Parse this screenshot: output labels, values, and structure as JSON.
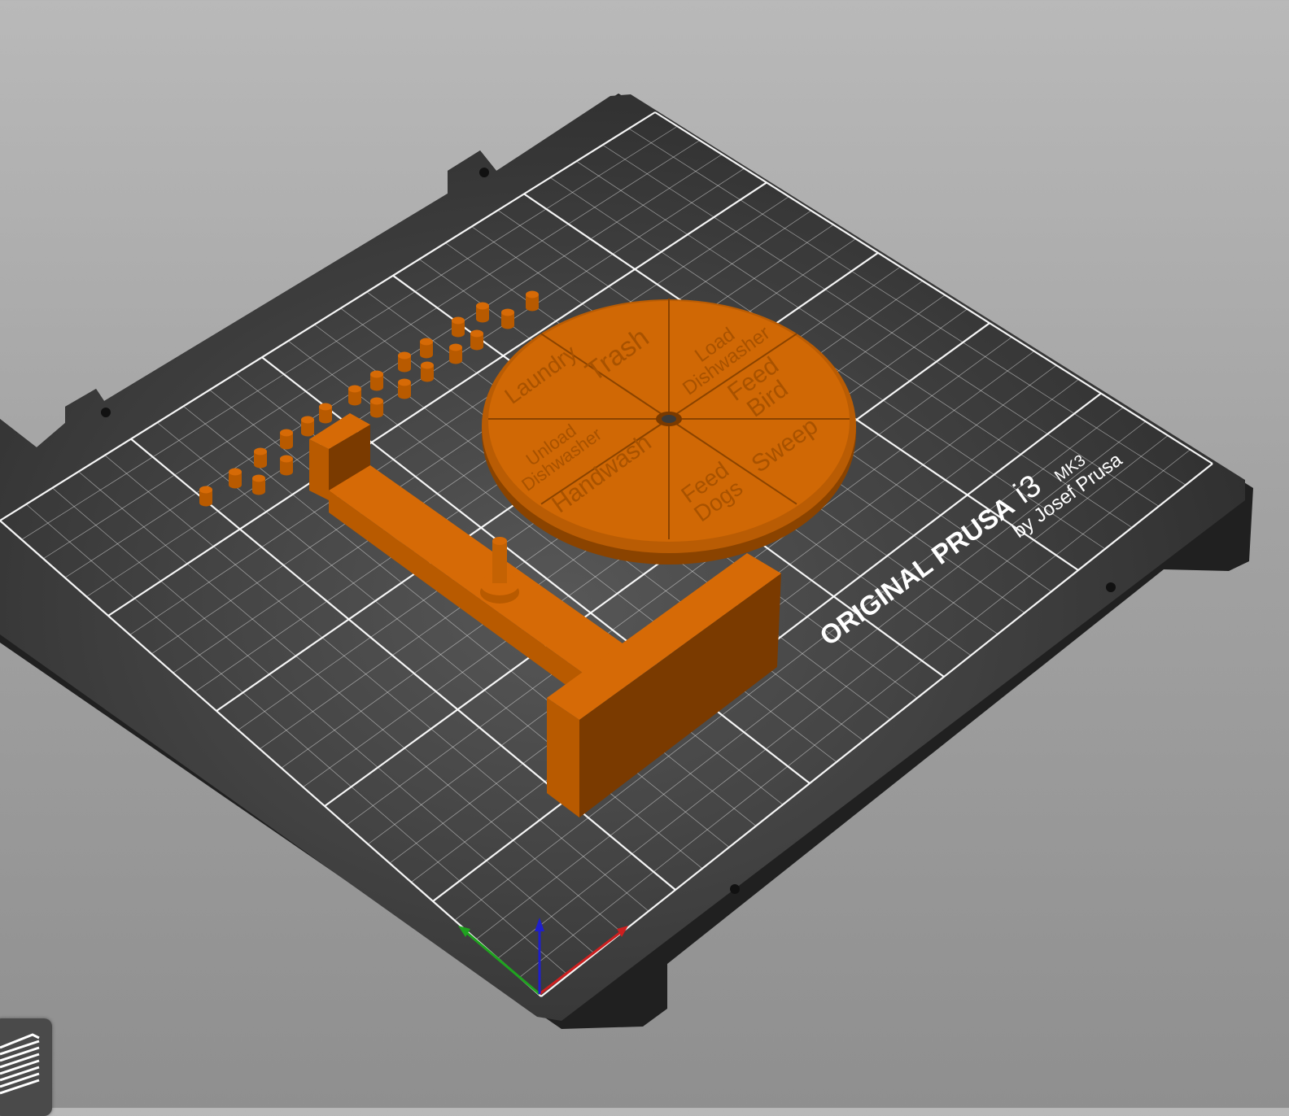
{
  "colors": {
    "background_top": "#b9b9b9",
    "background_bottom": "#8f8f8f",
    "bed": "#2f2f2f",
    "bed_edge": "#1e1e1e",
    "grid": "#ffffff",
    "model_top": "#d66a06",
    "model_side": "#7a3a00",
    "model_side_light": "#b85a00",
    "axis_x": "#cc1f1f",
    "axis_y": "#1fa31f",
    "axis_z": "#1f1fcc"
  },
  "bed_logo": {
    "brand": "ORIGINAL PRUSA",
    "model": "i3",
    "version": "MK3",
    "author": "by Josef Prusa"
  },
  "chore_wheel": {
    "segments": [
      "Trash",
      "Load\nDishwasher",
      "Feed\nBird",
      "Sweep",
      "Feed\nDogs",
      "Handwash",
      "Unload\nDishwasher",
      "Laundry"
    ]
  },
  "icons": {
    "layers": "layers-stack-icon",
    "axes": "axes-gizmo-icon"
  }
}
